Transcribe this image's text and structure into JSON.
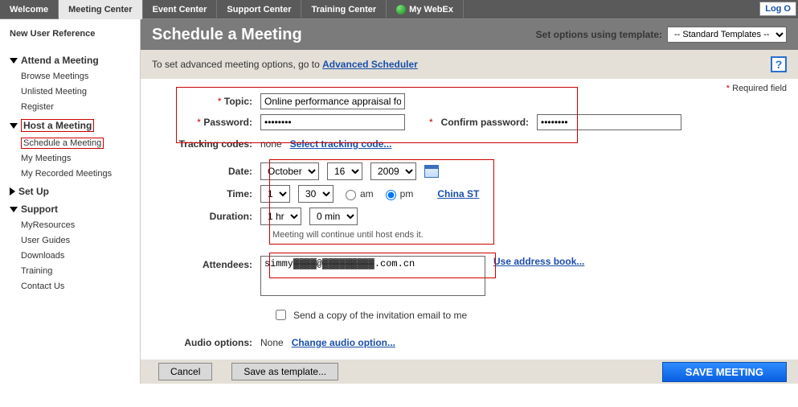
{
  "topnav": {
    "tabs": [
      "Welcome",
      "Meeting Center",
      "Event Center",
      "Support Center",
      "Training Center",
      "My WebEx"
    ],
    "active_index": 1,
    "log_label": "Log O"
  },
  "sidebar": {
    "new_user": "New User Reference",
    "attend": {
      "heading": "Attend a Meeting",
      "items": [
        "Browse Meetings",
        "Unlisted Meeting",
        "Register"
      ]
    },
    "host": {
      "heading": "Host a Meeting",
      "items": [
        "Schedule a Meeting",
        "My Meetings",
        "My Recorded Meetings"
      ]
    },
    "setup": {
      "heading": "Set Up"
    },
    "support": {
      "heading": "Support",
      "items": [
        "MyResources",
        "User Guides",
        "Downloads",
        "Training",
        "Contact Us"
      ]
    }
  },
  "header": {
    "title": "Schedule a Meeting",
    "template_label": "Set options using template:",
    "template_value": "-- Standard Templates --"
  },
  "advanced": {
    "prefix": "To set advanced meeting options, go to ",
    "link": "Advanced Scheduler"
  },
  "required_note": "Required field",
  "form": {
    "topic_label": "Topic:",
    "topic_value": "Online performance appraisal fo",
    "password_label": "Password:",
    "password_value": "••••••••",
    "confirm_label": "Confirm password:",
    "confirm_value": "••••••••",
    "tracking_label": "Tracking codes:",
    "tracking_none": "none",
    "tracking_link": "Select tracking code...",
    "date_label": "Date:",
    "month": "October",
    "day": "16",
    "year": "2009",
    "time_label": "Time:",
    "hour": "1",
    "minute": "30",
    "am": "am",
    "pm": "pm",
    "tz_link": "China ST",
    "duration_label": "Duration:",
    "dur_hr": "1 hr",
    "dur_min": "0 min",
    "duration_note": "Meeting will continue until host ends it.",
    "attendees_label": "Attendees:",
    "attendees_value": "simmy▓▓▓▓@▓▓▓▓▓▓▓▓▓.com.cn",
    "addressbook_link": "Use address book...",
    "sendcopy_label": "Send a copy of the invitation email to me",
    "audio_label": "Audio options:",
    "audio_none": "None",
    "audio_link": "Change audio option..."
  },
  "footer": {
    "cancel": "Cancel",
    "save_template": "Save as template...",
    "save": "SAVE MEETING"
  }
}
